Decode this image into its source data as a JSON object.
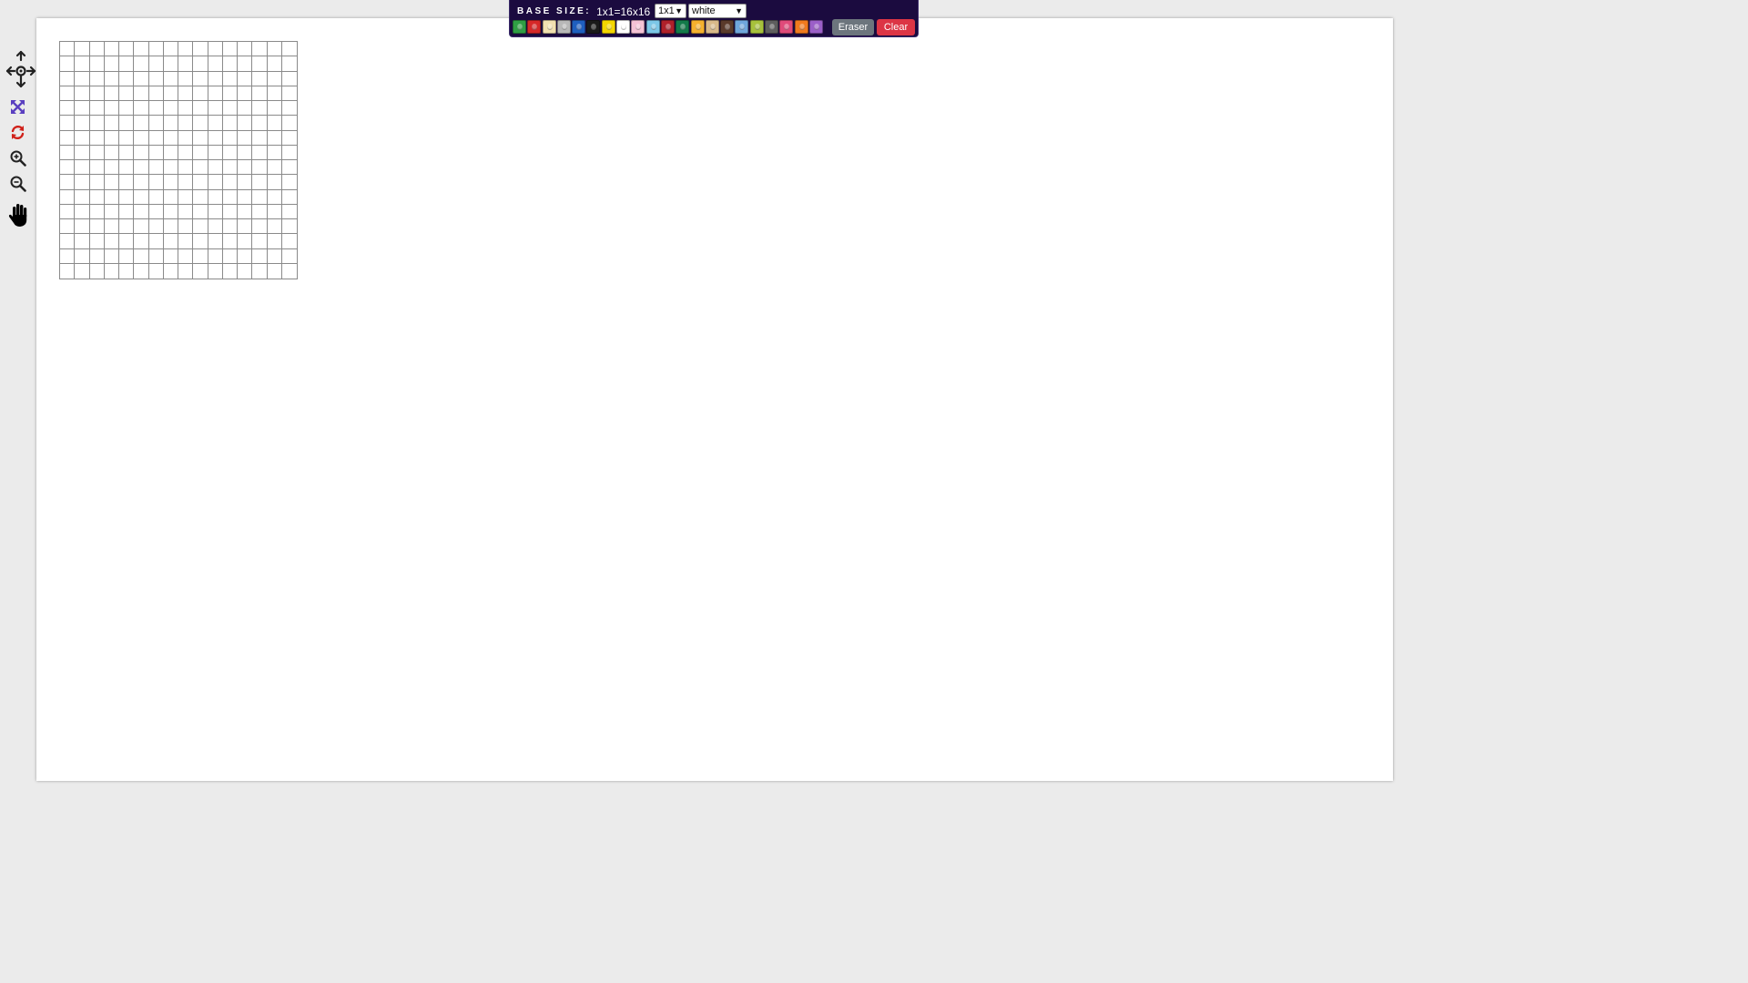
{
  "toolbar": {
    "base_size_label": "BASE SIZE:",
    "base_size_value": "1x1=16x16",
    "size_select": {
      "value": "1x1"
    },
    "color_select": {
      "value": "white"
    },
    "eraser_label": "Eraser",
    "clear_label": "Clear",
    "swatches": [
      {
        "name": "green",
        "color": "#2f9e44"
      },
      {
        "name": "red",
        "color": "#d62828"
      },
      {
        "name": "tan",
        "color": "#f1e0b0"
      },
      {
        "name": "light-gray",
        "color": "#b8b8b8"
      },
      {
        "name": "blue",
        "color": "#1f5fbf"
      },
      {
        "name": "black",
        "color": "#1a1a1a"
      },
      {
        "name": "yellow",
        "color": "#f4d600"
      },
      {
        "name": "white",
        "color": "#ffffff"
      },
      {
        "name": "pink",
        "color": "#f5c2d6"
      },
      {
        "name": "light-blue",
        "color": "#7cc7e8"
      },
      {
        "name": "dark-red",
        "color": "#b0202a"
      },
      {
        "name": "dark-green",
        "color": "#137a4a"
      },
      {
        "name": "orange-yellow",
        "color": "#f5b02e"
      },
      {
        "name": "beige",
        "color": "#d9b98a"
      },
      {
        "name": "brown",
        "color": "#5a3a2a"
      },
      {
        "name": "sky-blue",
        "color": "#6fa6dc"
      },
      {
        "name": "lime",
        "color": "#a7c13c"
      },
      {
        "name": "dark-gray",
        "color": "#5e5e5e"
      },
      {
        "name": "hot-pink",
        "color": "#e04a7a"
      },
      {
        "name": "orange",
        "color": "#f07a1e"
      },
      {
        "name": "purple",
        "color": "#9b5fc8"
      }
    ]
  },
  "side_tools": [
    {
      "name": "pan-arrows-icon",
      "color": "#222222"
    },
    {
      "name": "fit-screen-icon",
      "color": "#5a3fc0"
    },
    {
      "name": "reset-icon",
      "color": "#d0211a"
    },
    {
      "name": "zoom-in-icon",
      "color": "#222222"
    },
    {
      "name": "zoom-out-icon",
      "color": "#222222"
    },
    {
      "name": "hand-icon",
      "color": "#000000"
    }
  ],
  "grid": {
    "rows": 16,
    "cols": 16
  }
}
